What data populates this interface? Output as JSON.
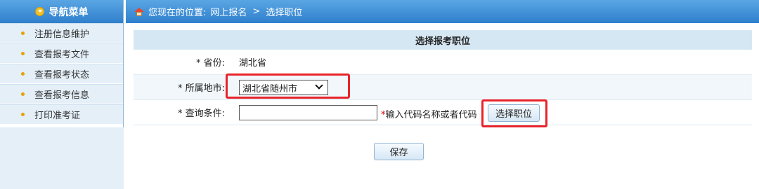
{
  "sidebar": {
    "title": "导航菜单",
    "items": [
      {
        "label": "注册信息维护"
      },
      {
        "label": "查看报考文件"
      },
      {
        "label": "查看报考状态"
      },
      {
        "label": "查看报考信息"
      },
      {
        "label": "打印准考证"
      }
    ]
  },
  "breadcrumb": {
    "prefix": "您现在的位置:",
    "path": "网上报名",
    "separator": ">",
    "current": "选择职位"
  },
  "form": {
    "title": "选择报考职位",
    "province_label": "* 省份:",
    "province_value": "湖北省",
    "city_label": "* 所属地市:",
    "city_selected": "湖北省随州市",
    "query_label": "* 查询条件:",
    "query_value": "",
    "query_hint_star": "*",
    "query_hint": "输入代码名称或者代码",
    "select_post_button": "选择职位",
    "save_button": "保存"
  },
  "colors": {
    "header_blue": "#3b8ad6",
    "highlight_red": "#e8232a",
    "bullet_orange": "#e5a200"
  }
}
